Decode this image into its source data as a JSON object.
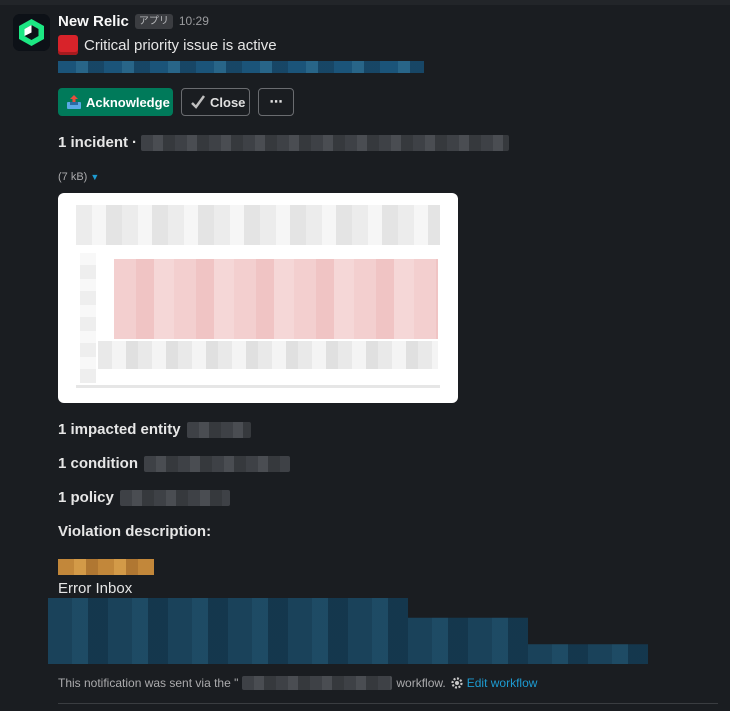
{
  "message": {
    "sender": "New Relic",
    "app_badge": "アプリ",
    "time": "10:29",
    "title": "Critical priority issue is active"
  },
  "actions": {
    "acknowledge_label": "Acknowledge",
    "close_label": "Close",
    "more_label": "⋯"
  },
  "incident": {
    "label": "1 incident",
    "separator": "·"
  },
  "attachment": {
    "size": "(7 kB)"
  },
  "details": {
    "entity_label": "1 impacted entity",
    "condition_label": "1 condition",
    "policy_label": "1 policy",
    "violation_heading": "Violation description:",
    "error_inbox": "Error Inbox"
  },
  "footer": {
    "prefix": "This notification was sent via the \"",
    "suffix": "workflow.",
    "edit_label": "Edit workflow"
  },
  "colors": {
    "background": "#1a1d21",
    "primary_button": "#007a5a",
    "link": "#1d9bd1",
    "critical": "#d8232a"
  }
}
